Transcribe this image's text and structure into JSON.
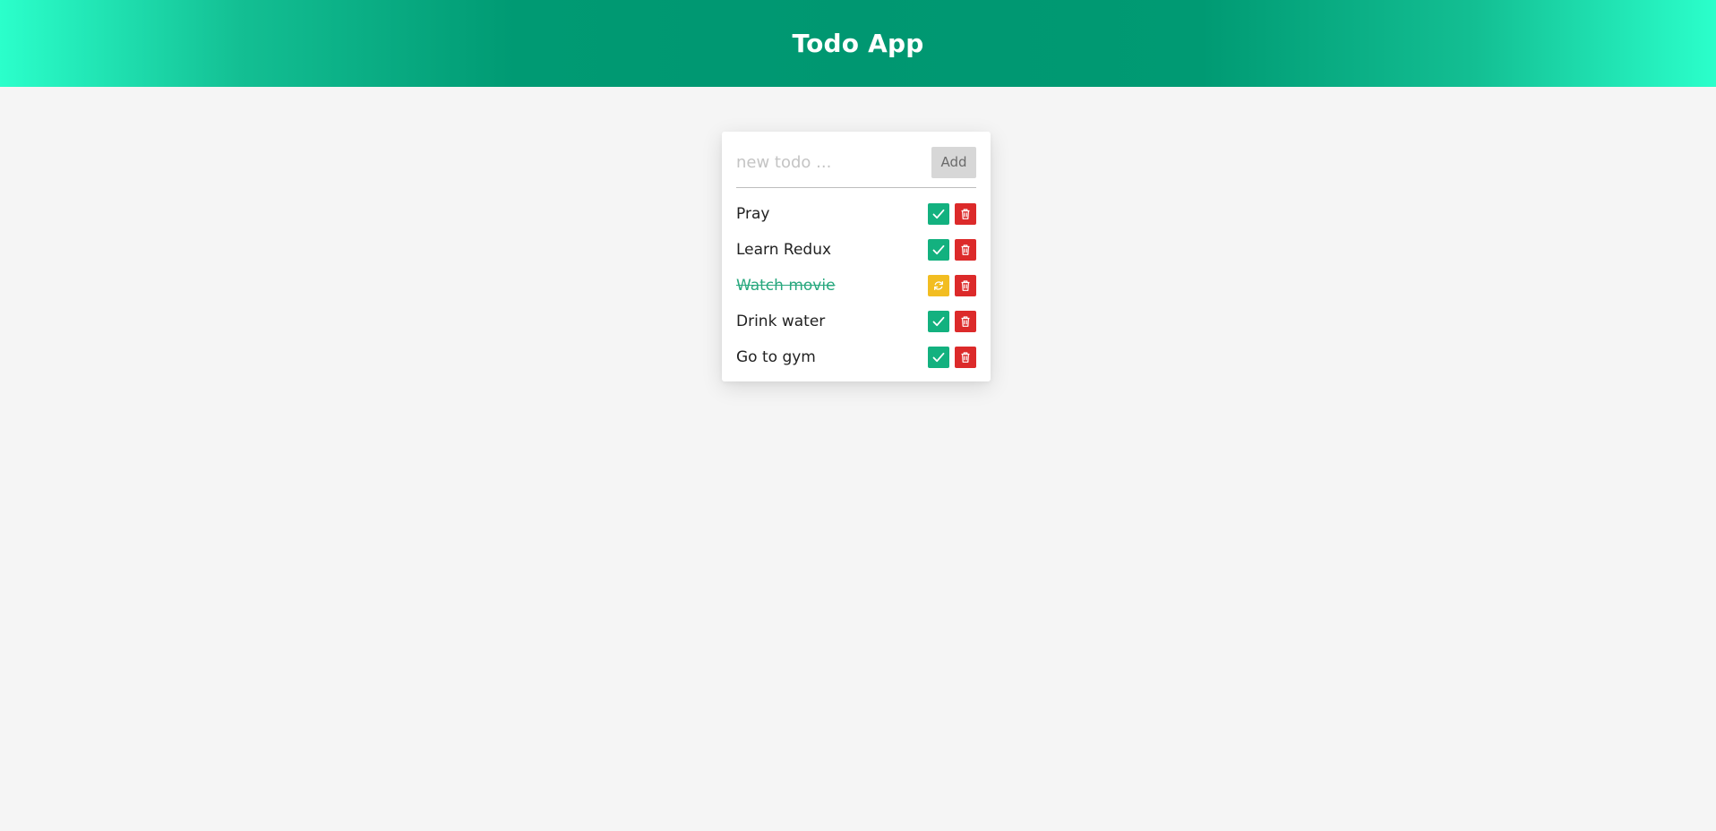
{
  "header": {
    "title": "Todo App"
  },
  "form": {
    "placeholder": "new todo ...",
    "value": "",
    "add_label": "Add"
  },
  "todos": [
    {
      "text": "Pray",
      "completed": false
    },
    {
      "text": "Learn Redux",
      "completed": false
    },
    {
      "text": "Watch movie",
      "completed": true
    },
    {
      "text": "Drink water",
      "completed": false
    },
    {
      "text": "Go to gym",
      "completed": false
    }
  ],
  "icons": {
    "complete": "check-icon",
    "undo": "refresh-icon",
    "delete": "trash-icon"
  },
  "colors": {
    "header_dark": "#009771",
    "header_light": "#2bffcb",
    "check": "#13b17f",
    "undo": "#f2bd21",
    "delete": "#dc2a2a",
    "completed_text": "#28a87e"
  }
}
